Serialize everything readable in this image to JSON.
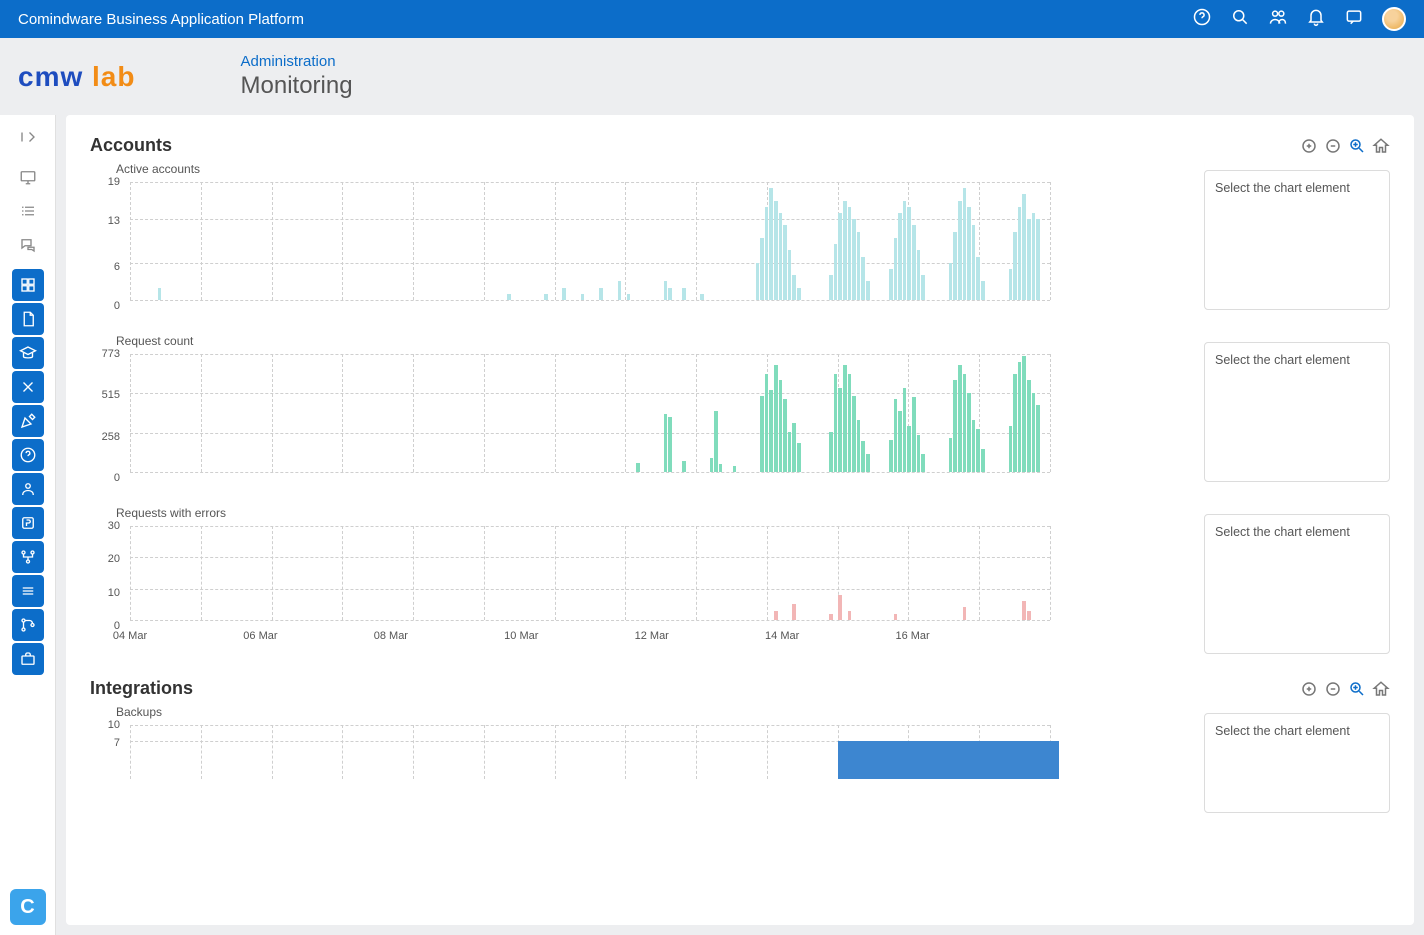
{
  "topbar": {
    "title": "Comindware Business Application Platform",
    "icons": [
      "help-icon",
      "search-icon",
      "users-icon",
      "bell-icon",
      "feedback-icon",
      "avatar"
    ]
  },
  "logo": {
    "part1": "cmw",
    "part2": "lab"
  },
  "breadcrumb": {
    "category": "Administration",
    "page": "Monitoring"
  },
  "sidebar_tile": "C",
  "sections": [
    {
      "title": "Accounts",
      "tools": [
        "plus",
        "minus",
        "zoom",
        "home"
      ]
    },
    {
      "title": "Integrations",
      "tools": [
        "plus",
        "minus",
        "zoom",
        "home"
      ]
    }
  ],
  "infobox_placeholder": "Select the chart element",
  "xaxis_labels": [
    "04 Mar",
    "06 Mar",
    "08 Mar",
    "10 Mar",
    "12 Mar",
    "14 Mar",
    "16 Mar"
  ],
  "chart_data": [
    {
      "type": "bar",
      "title": "Active accounts",
      "ylabels": [
        19,
        13,
        6,
        0
      ],
      "ylim": [
        0,
        19
      ],
      "color": "#b6e5e8",
      "series": [
        {
          "p": 0.03,
          "v": 2
        },
        {
          "p": 0.41,
          "v": 1
        },
        {
          "p": 0.45,
          "v": 1
        },
        {
          "p": 0.47,
          "v": 2
        },
        {
          "p": 0.49,
          "v": 1
        },
        {
          "p": 0.51,
          "v": 2
        },
        {
          "p": 0.53,
          "v": 3
        },
        {
          "p": 0.54,
          "v": 1
        },
        {
          "p": 0.58,
          "v": 3
        },
        {
          "p": 0.585,
          "v": 2
        },
        {
          "p": 0.6,
          "v": 2
        },
        {
          "p": 0.62,
          "v": 1
        },
        {
          "p": 0.68,
          "v": 6
        },
        {
          "p": 0.685,
          "v": 10
        },
        {
          "p": 0.69,
          "v": 15
        },
        {
          "p": 0.695,
          "v": 18
        },
        {
          "p": 0.7,
          "v": 16
        },
        {
          "p": 0.705,
          "v": 14
        },
        {
          "p": 0.71,
          "v": 12
        },
        {
          "p": 0.715,
          "v": 8
        },
        {
          "p": 0.72,
          "v": 4
        },
        {
          "p": 0.725,
          "v": 2
        },
        {
          "p": 0.76,
          "v": 4
        },
        {
          "p": 0.765,
          "v": 9
        },
        {
          "p": 0.77,
          "v": 14
        },
        {
          "p": 0.775,
          "v": 16
        },
        {
          "p": 0.78,
          "v": 15
        },
        {
          "p": 0.785,
          "v": 13
        },
        {
          "p": 0.79,
          "v": 11
        },
        {
          "p": 0.795,
          "v": 7
        },
        {
          "p": 0.8,
          "v": 3
        },
        {
          "p": 0.825,
          "v": 5
        },
        {
          "p": 0.83,
          "v": 10
        },
        {
          "p": 0.835,
          "v": 14
        },
        {
          "p": 0.84,
          "v": 16
        },
        {
          "p": 0.845,
          "v": 15
        },
        {
          "p": 0.85,
          "v": 12
        },
        {
          "p": 0.855,
          "v": 8
        },
        {
          "p": 0.86,
          "v": 4
        },
        {
          "p": 0.89,
          "v": 6
        },
        {
          "p": 0.895,
          "v": 11
        },
        {
          "p": 0.9,
          "v": 16
        },
        {
          "p": 0.905,
          "v": 18
        },
        {
          "p": 0.91,
          "v": 15
        },
        {
          "p": 0.915,
          "v": 12
        },
        {
          "p": 0.92,
          "v": 7
        },
        {
          "p": 0.925,
          "v": 3
        },
        {
          "p": 0.955,
          "v": 5
        },
        {
          "p": 0.96,
          "v": 11
        },
        {
          "p": 0.965,
          "v": 15
        },
        {
          "p": 0.97,
          "v": 17
        },
        {
          "p": 0.975,
          "v": 13
        },
        {
          "p": 0.98,
          "v": 14
        },
        {
          "p": 0.985,
          "v": 13
        }
      ]
    },
    {
      "type": "bar",
      "title": "Request count",
      "ylabels": [
        773,
        515,
        258,
        0
      ],
      "ylim": [
        0,
        773
      ],
      "color": "#80dcbc",
      "series": [
        {
          "p": 0.55,
          "v": 60
        },
        {
          "p": 0.58,
          "v": 380
        },
        {
          "p": 0.585,
          "v": 360
        },
        {
          "p": 0.6,
          "v": 70
        },
        {
          "p": 0.63,
          "v": 90
        },
        {
          "p": 0.635,
          "v": 400
        },
        {
          "p": 0.64,
          "v": 50
        },
        {
          "p": 0.655,
          "v": 40
        },
        {
          "p": 0.685,
          "v": 500
        },
        {
          "p": 0.69,
          "v": 640
        },
        {
          "p": 0.695,
          "v": 540
        },
        {
          "p": 0.7,
          "v": 700
        },
        {
          "p": 0.705,
          "v": 600
        },
        {
          "p": 0.71,
          "v": 480
        },
        {
          "p": 0.715,
          "v": 260
        },
        {
          "p": 0.72,
          "v": 320
        },
        {
          "p": 0.725,
          "v": 190
        },
        {
          "p": 0.76,
          "v": 260
        },
        {
          "p": 0.765,
          "v": 640
        },
        {
          "p": 0.77,
          "v": 550
        },
        {
          "p": 0.775,
          "v": 700
        },
        {
          "p": 0.78,
          "v": 640
        },
        {
          "p": 0.785,
          "v": 500
        },
        {
          "p": 0.79,
          "v": 340
        },
        {
          "p": 0.795,
          "v": 200
        },
        {
          "p": 0.8,
          "v": 120
        },
        {
          "p": 0.825,
          "v": 210
        },
        {
          "p": 0.83,
          "v": 480
        },
        {
          "p": 0.835,
          "v": 400
        },
        {
          "p": 0.84,
          "v": 550
        },
        {
          "p": 0.845,
          "v": 300
        },
        {
          "p": 0.85,
          "v": 490
        },
        {
          "p": 0.855,
          "v": 240
        },
        {
          "p": 0.86,
          "v": 120
        },
        {
          "p": 0.89,
          "v": 220
        },
        {
          "p": 0.895,
          "v": 600
        },
        {
          "p": 0.9,
          "v": 700
        },
        {
          "p": 0.905,
          "v": 640
        },
        {
          "p": 0.91,
          "v": 520
        },
        {
          "p": 0.915,
          "v": 340
        },
        {
          "p": 0.92,
          "v": 280
        },
        {
          "p": 0.925,
          "v": 150
        },
        {
          "p": 0.955,
          "v": 300
        },
        {
          "p": 0.96,
          "v": 640
        },
        {
          "p": 0.965,
          "v": 720
        },
        {
          "p": 0.97,
          "v": 760
        },
        {
          "p": 0.975,
          "v": 600
        },
        {
          "p": 0.98,
          "v": 520
        },
        {
          "p": 0.985,
          "v": 440
        }
      ]
    },
    {
      "type": "bar",
      "title": "Requests with errors",
      "ylabels": [
        30,
        20,
        10,
        0
      ],
      "ylim": [
        0,
        30
      ],
      "color": "#f2b6b6",
      "series": [
        {
          "p": 0.7,
          "v": 3
        },
        {
          "p": 0.72,
          "v": 5
        },
        {
          "p": 0.76,
          "v": 2
        },
        {
          "p": 0.77,
          "v": 8
        },
        {
          "p": 0.78,
          "v": 3
        },
        {
          "p": 0.83,
          "v": 2
        },
        {
          "p": 0.905,
          "v": 4
        },
        {
          "p": 0.97,
          "v": 6
        },
        {
          "p": 0.975,
          "v": 3
        }
      ]
    },
    {
      "type": "bar",
      "title": "Backups",
      "ylabels": [
        10,
        7
      ],
      "ylim": [
        0,
        10
      ],
      "color": "#3d86d0",
      "series": [
        {
          "p": 0.77,
          "w": 0.24,
          "v": 7
        }
      ]
    }
  ]
}
